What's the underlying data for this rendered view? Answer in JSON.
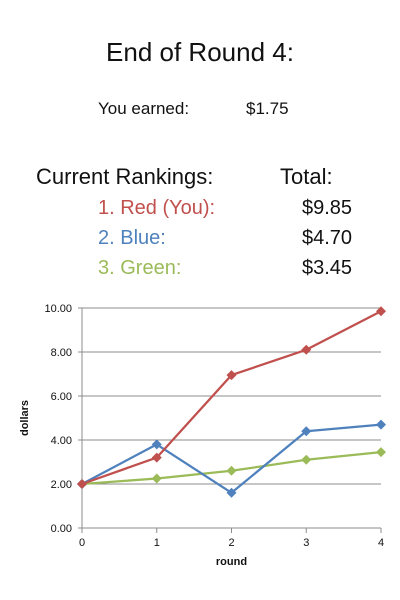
{
  "header": {
    "title": "End of Round 4:",
    "earned_label": "You earned:",
    "earned_value": "$1.75"
  },
  "rankings": {
    "heading": "Current Rankings:",
    "total_heading": "Total:",
    "rows": [
      {
        "label": "1. Red (You):",
        "total": "$9.85",
        "color": "#C0504D"
      },
      {
        "label": "2. Blue:",
        "total": "$4.70",
        "color": "#4F81BD"
      },
      {
        "label": "3. Green:",
        "total": "$3.45",
        "color": "#9BBB59"
      }
    ]
  },
  "chart_data": {
    "type": "line",
    "title": "",
    "xlabel": "round",
    "ylabel": "dollars",
    "x": [
      0,
      1,
      2,
      3,
      4
    ],
    "xlim": [
      0,
      4
    ],
    "ylim": [
      0,
      10
    ],
    "y_ticks": [
      "0.00",
      "2.00",
      "4.00",
      "6.00",
      "8.00",
      "10.00"
    ],
    "x_ticks": [
      "0",
      "1",
      "2",
      "3",
      "4"
    ],
    "grid": "horizontal",
    "marker": "diamond",
    "series": [
      {
        "color": "#C0504D",
        "values": [
          2.0,
          3.2,
          6.95,
          8.1,
          9.85
        ]
      },
      {
        "color": "#4F81BD",
        "values": [
          2.0,
          3.8,
          1.6,
          4.4,
          4.7
        ]
      },
      {
        "color": "#9BBB59",
        "values": [
          2.0,
          2.25,
          2.6,
          3.1,
          3.45
        ]
      }
    ]
  }
}
